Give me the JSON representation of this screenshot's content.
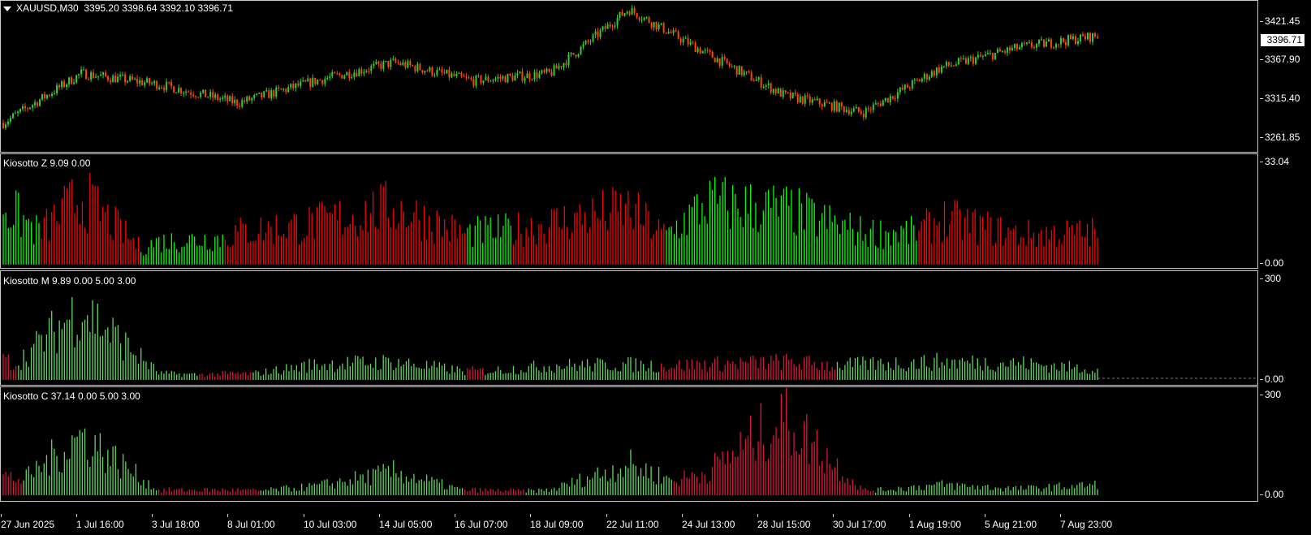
{
  "main": {
    "symbol_label": "XAUUSD,M30",
    "ohlc": "3395.20 3398.64 3392.10 3396.71",
    "current_price": "3396.71",
    "price_scale": [
      "3421.45",
      "3367.90",
      "3315.40",
      "3261.85"
    ]
  },
  "indicators": [
    {
      "label": "Kiosotto Z 9.09 0.00",
      "scale_top": "33.04",
      "scale_bottom": "0.00"
    },
    {
      "label": "Kiosotto M 9.89 0.00 5.00 3.00",
      "scale_top": "300",
      "scale_bottom": "0.00"
    },
    {
      "label": "Kiosotto C 37.14 0.00 5.00 3.00",
      "scale_top": "300",
      "scale_bottom": "0.00"
    }
  ],
  "time_axis": [
    "27 Jun 2025",
    "1 Jul 16:00",
    "3 Jul 18:00",
    "8 Jul 01:00",
    "10 Jul 03:00",
    "14 Jul 05:00",
    "16 Jul 07:00",
    "18 Jul 09:00",
    "22 Jul 11:00",
    "24 Jul 13:00",
    "28 Jul 15:00",
    "30 Jul 17:00",
    "1 Aug 19:00",
    "5 Aug 21:00",
    "7 Aug 23:00"
  ],
  "colors": {
    "background": "#000000",
    "bull": "#32cd32",
    "bear": "#ff4500",
    "hist_green": "#00ff00",
    "hist_red": "#ff0000",
    "hist_green_soft": "#5fd75f",
    "hist_red_soft": "#dc143c"
  },
  "chart_data": [
    {
      "type": "line",
      "title": "XAUUSD,M30",
      "x": [
        "27 Jun 2025",
        "1 Jul 16:00",
        "3 Jul 18:00",
        "8 Jul 01:00",
        "10 Jul 03:00",
        "14 Jul 05:00",
        "16 Jul 07:00",
        "18 Jul 09:00",
        "22 Jul 11:00",
        "24 Jul 13:00",
        "28 Jul 15:00",
        "30 Jul 17:00",
        "1 Aug 19:00",
        "5 Aug 21:00",
        "7 Aug 23:00"
      ],
      "series": [
        {
          "values": [
            3278,
            3345,
            3330,
            3305,
            3335,
            3360,
            3335,
            3345,
            3432,
            3372,
            3315,
            3292,
            3353,
            3380,
            3396
          ]
        }
      ],
      "ylim": [
        3240,
        3440
      ]
    },
    {
      "type": "bar",
      "title": "Kiosotto Z 9.09 0.00",
      "x": [
        "27 Jun 2025",
        "1 Jul 16:00",
        "3 Jul 18:00",
        "8 Jul 01:00",
        "10 Jul 03:00",
        "14 Jul 05:00",
        "16 Jul 07:00",
        "18 Jul 09:00",
        "22 Jul 11:00",
        "24 Jul 13:00",
        "28 Jul 15:00",
        "30 Jul 17:00",
        "1 Aug 19:00",
        "5 Aug 21:00",
        "7 Aug 23:00"
      ],
      "series": [
        {
          "values": [
            26,
            0,
            10,
            12,
            15,
            0,
            14,
            16,
            0,
            27,
            24,
            14,
            14,
            11,
            9
          ]
        },
        {
          "values": [
            0,
            30,
            0,
            14,
            18,
            25,
            12,
            18,
            24,
            0,
            0,
            0,
            20,
            13,
            14
          ]
        }
      ],
      "ylim": [
        0,
        33.04
      ]
    },
    {
      "type": "bar",
      "title": "Kiosotto M 9.89 0.00 5.00 3.00",
      "x": [
        "27 Jun 2025",
        "1 Jul 16:00",
        "3 Jul 18:00",
        "8 Jul 01:00",
        "10 Jul 03:00",
        "14 Jul 05:00",
        "16 Jul 07:00",
        "18 Jul 09:00",
        "22 Jul 11:00",
        "24 Jul 13:00",
        "28 Jul 15:00",
        "30 Jul 17:00",
        "1 Aug 19:00",
        "5 Aug 21:00",
        "7 Aug 23:00"
      ],
      "series": [
        {
          "values": [
            20,
            280,
            25,
            15,
            60,
            70,
            30,
            55,
            60,
            45,
            50,
            60,
            70,
            65,
            40
          ]
        },
        {
          "values": [
            75,
            20,
            15,
            25,
            15,
            20,
            35,
            30,
            50,
            60,
            70,
            50,
            30,
            20,
            15
          ]
        }
      ],
      "ylim": [
        0,
        300
      ]
    },
    {
      "type": "bar",
      "title": "Kiosotto C 37.14 0.00 5.00 3.00",
      "x": [
        "27 Jun 2025",
        "1 Jul 16:00",
        "3 Jul 18:00",
        "8 Jul 01:00",
        "10 Jul 03:00",
        "14 Jul 05:00",
        "16 Jul 07:00",
        "18 Jul 09:00",
        "22 Jul 11:00",
        "24 Jul 13:00",
        "28 Jul 15:00",
        "30 Jul 17:00",
        "1 Aug 19:00",
        "5 Aug 21:00",
        "7 Aug 23:00"
      ],
      "series": [
        {
          "values": [
            0,
            230,
            15,
            10,
            35,
            90,
            10,
            20,
            120,
            10,
            0,
            15,
            40,
            25,
            40
          ]
        },
        {
          "values": [
            75,
            10,
            20,
            20,
            10,
            10,
            20,
            15,
            10,
            90,
            300,
            20,
            10,
            5,
            5
          ]
        }
      ],
      "ylim": [
        0,
        300
      ]
    }
  ]
}
